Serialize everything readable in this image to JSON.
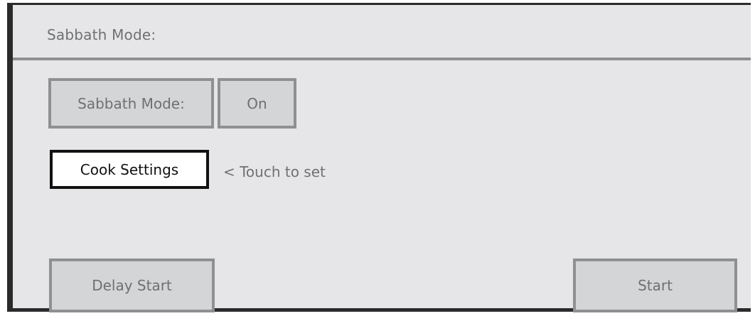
{
  "header": {
    "title": "Sabbath Mode:"
  },
  "sabbath_mode": {
    "label": "Sabbath Mode:",
    "value": "On"
  },
  "cook_settings": {
    "label": "Cook Settings",
    "hint": "< Touch to set"
  },
  "footer": {
    "delay_start_label": "Delay Start",
    "start_label": "Start"
  },
  "colors": {
    "background": "#e6e6e8",
    "frame": "#2a2a2a",
    "button_fill": "#d4d5d6",
    "button_border": "#8f9091",
    "text_grey": "#6f7071",
    "active_button_fill": "#ffffff",
    "active_button_border": "#111111"
  }
}
